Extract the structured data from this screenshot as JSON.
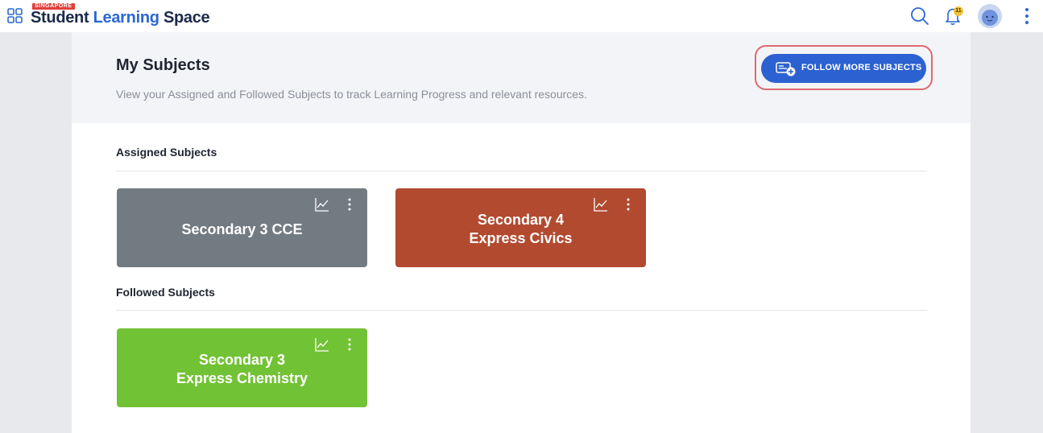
{
  "header": {
    "logo_region": "SINGAPORE",
    "logo_part1": "Student",
    "logo_part2": "Learning",
    "logo_part3": "Space",
    "notification_count": "11",
    "icons": [
      "apps-grid-icon",
      "search-icon",
      "bell-icon",
      "avatar",
      "more-vertical-icon"
    ]
  },
  "page": {
    "title": "My Subjects",
    "subtitle": "View your Assigned and Followed Subjects to track Learning Progress and relevant resources.",
    "follow_button_label": "FOLLOW MORE SUBJECTS"
  },
  "assigned": {
    "heading": "Assigned Subjects",
    "cards": [
      {
        "title": "Secondary 3 CCE",
        "color": "#737b82"
      },
      {
        "title": "Secondary 4\nExpress Civics",
        "color": "#b24a30"
      }
    ]
  },
  "followed": {
    "heading": "Followed Subjects",
    "cards": [
      {
        "title": "Secondary 3\nExpress Chemistry",
        "color": "#72c235"
      }
    ]
  },
  "colors": {
    "accent": "#2b61d1",
    "highlight_outline": "#de6a72"
  }
}
